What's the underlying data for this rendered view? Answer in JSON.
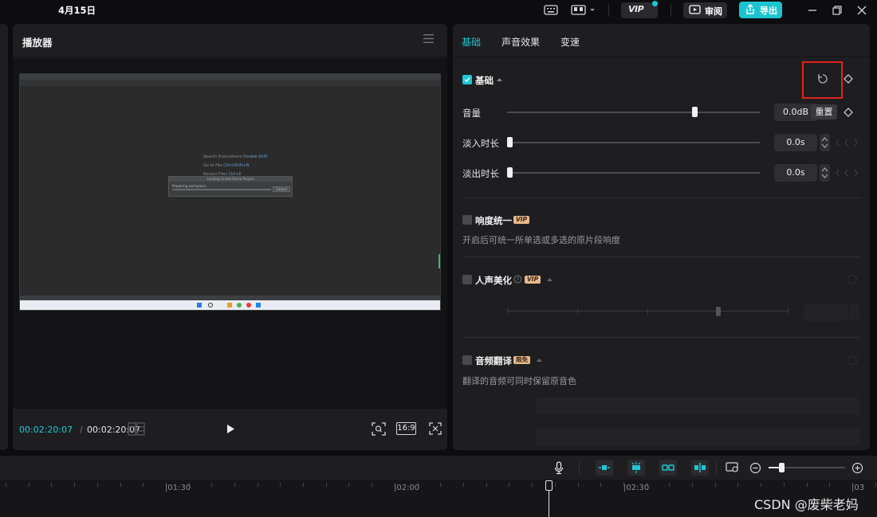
{
  "topbar": {
    "date": "4月15日",
    "review_label": "审阅",
    "export_label": "导出",
    "vip_label": "VIP"
  },
  "player": {
    "title": "播放器",
    "current_time": "00:02:20:07",
    "separator": "/",
    "total_time": "00:02:20:07",
    "ratio_label": "16:9",
    "video": {
      "hint1_label": "Search Everywhere",
      "hint1_key": "Double Shift",
      "hint2_label": "Go to File",
      "hint2_key": "Ctrl+Shift+N",
      "hint3_label": "Recent Files",
      "hint3_key": "Ctrl+E",
      "dialog_title": "Loading Gradle Demo Project",
      "dialog_text": "Preparing workspace...",
      "dialog_button": "Cancel"
    }
  },
  "audio_panel": {
    "tabs": [
      "基础",
      "声音效果",
      "变速"
    ],
    "basic": {
      "title": "基础",
      "volume_label": "音量",
      "volume_value": "0.0dB",
      "volume_level": 0.67,
      "fade_in_label": "淡入时长",
      "fade_in_value": "0.0s",
      "fade_out_label": "淡出时长",
      "fade_out_value": "0.0s",
      "reset_tooltip": "重置"
    },
    "loudness": {
      "title": "响度统一",
      "vip_tag": "VIP",
      "desc": "开启后可统一所单选或多选的原片段响度"
    },
    "voice_beautify": {
      "title": "人声美化",
      "vip_tag": "VIP"
    },
    "translate": {
      "title": "音频翻译",
      "free_tag": "限免",
      "desc": "翻译的音频可同时保留原音色"
    }
  },
  "timeline": {
    "ticks": [
      "|01:30",
      "|02:00",
      "|02:30",
      "|03"
    ],
    "zoom_level": 0.18
  },
  "watermark": "CSDN @废柴老妈",
  "colors": {
    "accent": "#1fc7d4",
    "highlight": "#e0231c",
    "vip": "#e8b98a"
  }
}
